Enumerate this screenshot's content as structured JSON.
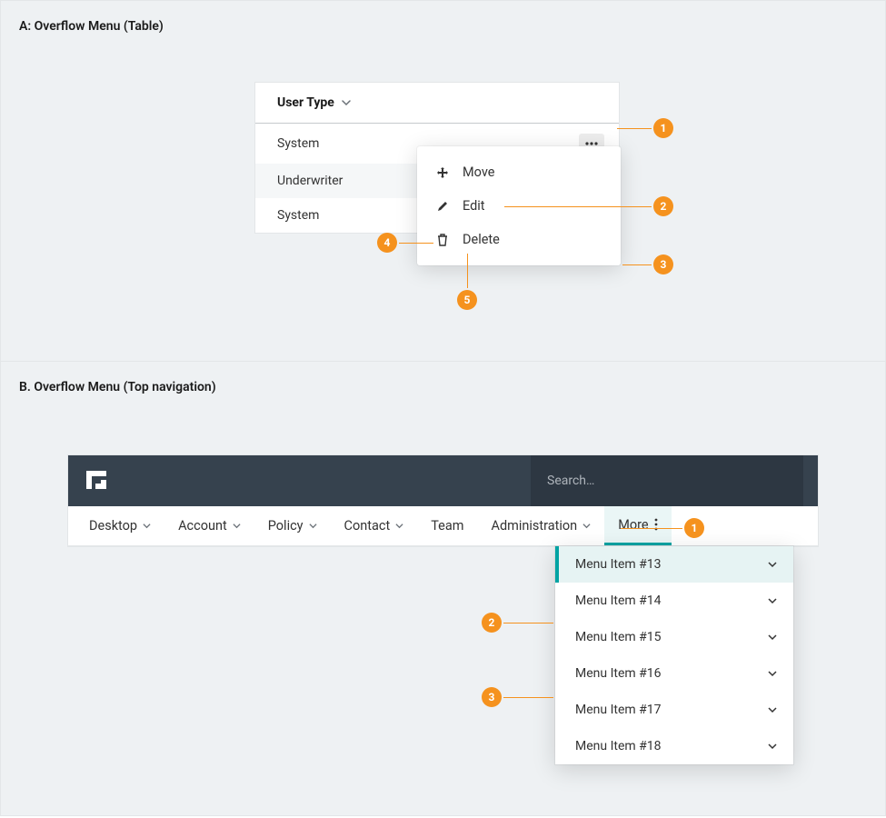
{
  "section_a": {
    "label": "A: Overflow Menu (Table)",
    "table": {
      "header": "User Type",
      "rows": [
        "System",
        "Underwriter",
        "System"
      ]
    },
    "menu": {
      "items": [
        {
          "icon": "move-icon",
          "label": "Move"
        },
        {
          "icon": "edit-icon",
          "label": "Edit"
        },
        {
          "icon": "delete-icon",
          "label": "Delete"
        }
      ]
    },
    "markers": [
      "1",
      "2",
      "3",
      "4",
      "5"
    ]
  },
  "section_b": {
    "label": "B. Overflow Menu (Top navigation)",
    "search_placeholder": "Search…",
    "nav": [
      {
        "label": "Desktop",
        "chev": true
      },
      {
        "label": "Account",
        "chev": true
      },
      {
        "label": "Policy",
        "chev": true
      },
      {
        "label": "Contact",
        "chev": true
      },
      {
        "label": "Team",
        "chev": false
      },
      {
        "label": "Administration",
        "chev": true
      }
    ],
    "more_label": "More",
    "dropdown": [
      "Menu Item #13",
      "Menu Item #14",
      "Menu Item #15",
      "Menu Item #16",
      "Menu Item #17",
      "Menu Item #18"
    ],
    "markers": [
      "1",
      "2",
      "3"
    ]
  },
  "colors": {
    "accent_orange": "#f5921e",
    "accent_teal": "#00a3a3",
    "header_bg": "#36424e"
  }
}
